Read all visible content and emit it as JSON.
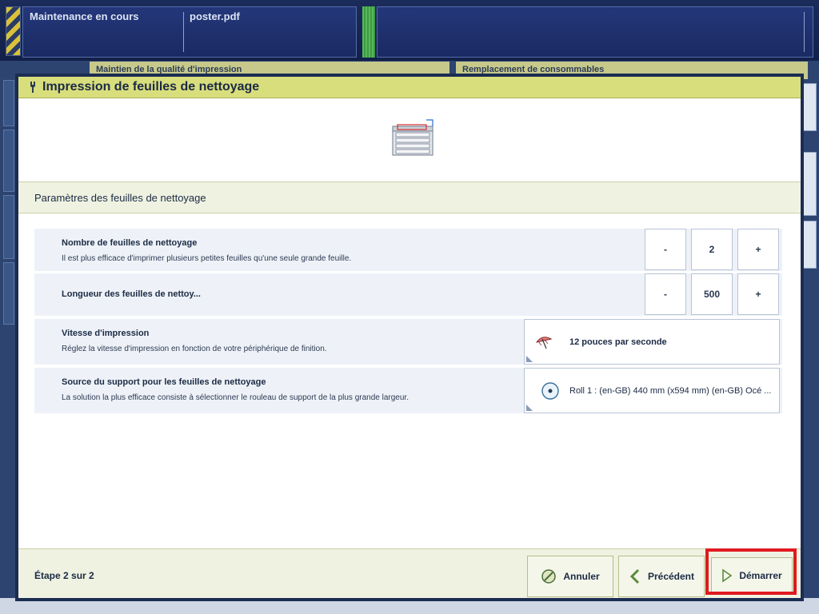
{
  "status_bar": {
    "job_status": "Maintenance en cours",
    "file_name": "poster.pdf"
  },
  "background": {
    "tab_left": "Maintien de la qualité d'impression",
    "tab_right": "Remplacement de consommables"
  },
  "dialog": {
    "title": "Impression de feuilles de nettoyage",
    "section_title": "Paramètres des feuilles de nettoyage",
    "settings": {
      "sheet_count": {
        "label": "Nombre de feuilles de nettoyage",
        "description": "Il est plus efficace d'imprimer plusieurs petites feuilles qu'une seule grande feuille.",
        "value": "2",
        "decrement": "-",
        "increment": "+"
      },
      "sheet_length": {
        "label": "Longueur des feuilles de nettoy...",
        "value": "500",
        "decrement": "-",
        "increment": "+"
      },
      "print_speed": {
        "label": "Vitesse d'impression",
        "description": "Réglez la vitesse d'impression en fonction de votre périphérique de finition.",
        "value": "12 pouces par seconde"
      },
      "media_source": {
        "label": "Source du support pour les feuilles de nettoyage",
        "description": "La solution la plus efficace consiste à sélectionner le rouleau de support de la plus grande largeur.",
        "value": "Roll 1 : (en-GB) 440 mm (x594 mm) (en-GB) Océ ..."
      }
    },
    "footer": {
      "step": "Étape 2 sur 2",
      "cancel": "Annuler",
      "previous": "Précédent",
      "start": "Démarrer"
    }
  },
  "colors": {
    "header_bg": "#d9de7d",
    "highlight": "#e0191f",
    "dialog_border": "#1b2d52"
  }
}
